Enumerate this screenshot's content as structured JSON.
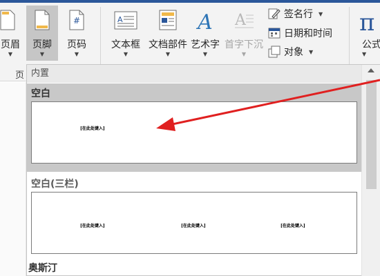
{
  "ribbon": {
    "buttons": {
      "header": "页眉",
      "footer": "页脚",
      "page_number": "页码",
      "text_box": "文本框",
      "quick_parts": "文档部件",
      "wordart": "艺术字",
      "drop_cap": "首字下沉",
      "equation": "公式"
    },
    "small_items": {
      "signature_line": "签名行",
      "date_time": "日期和时间",
      "object": "对象"
    },
    "group_label_partial": "页"
  },
  "dropdown": {
    "section_header": "内置",
    "items": [
      {
        "title": "空白",
        "placeholder": "[在此处键入]"
      },
      {
        "title": "空白(三栏)",
        "placeholders": [
          "[在此处键入]",
          "[在此处键入]",
          "[在此处键入]"
        ]
      },
      {
        "title": "奥斯汀"
      }
    ]
  },
  "colors": {
    "title_bar": "#2b579a",
    "selected_item": "#c8c8c8",
    "annotation_arrow": "#e02020"
  },
  "icons": [
    "footer-icon",
    "page-number-icon",
    "text-box-icon",
    "quick-parts-icon",
    "wordart-icon",
    "drop-cap-icon",
    "signature-line-icon",
    "date-time-icon",
    "object-icon",
    "equation-icon"
  ]
}
